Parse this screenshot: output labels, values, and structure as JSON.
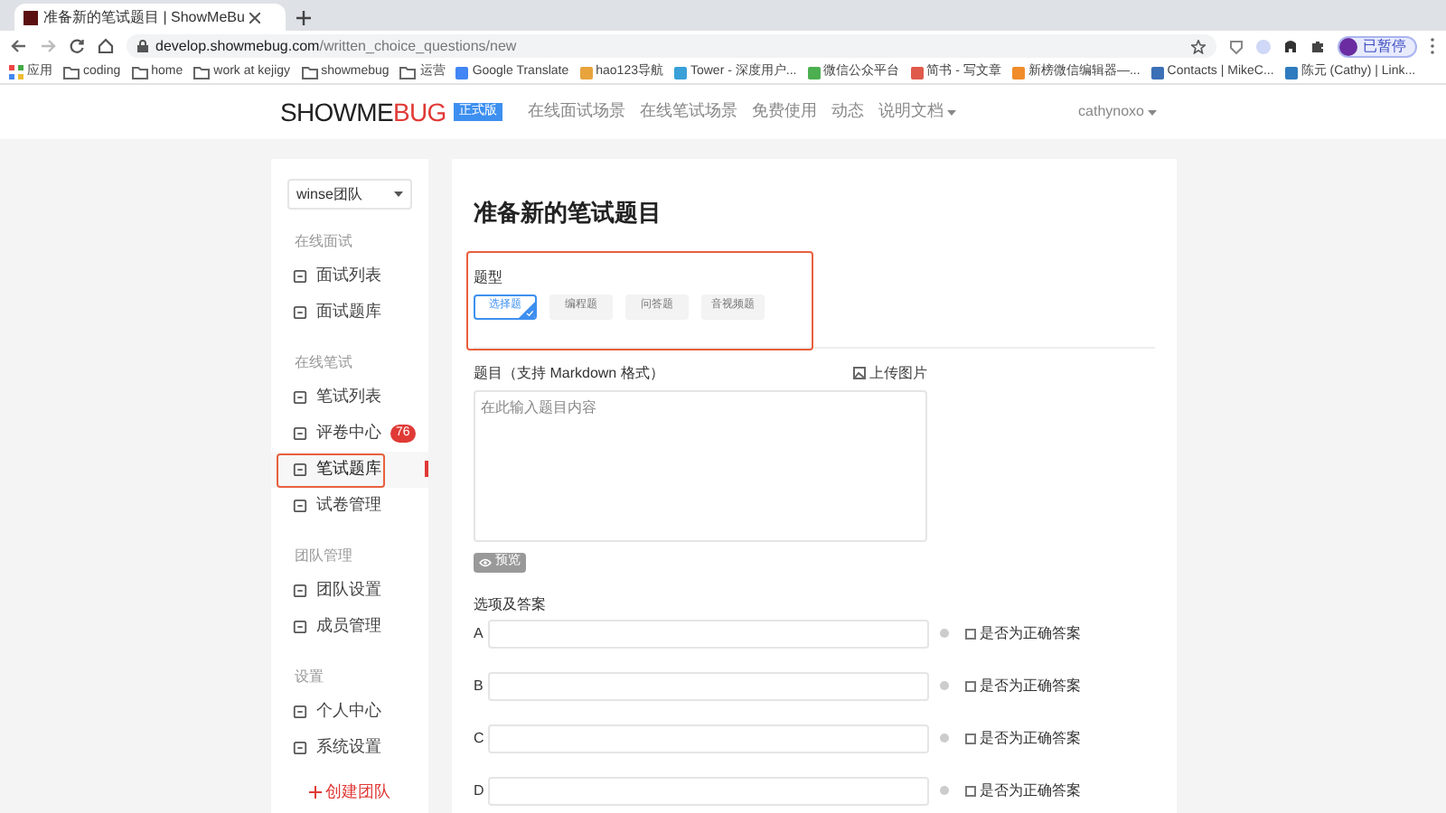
{
  "browser": {
    "tab_title": "准备新的笔试题目 | ShowMeBu",
    "url_host": "develop.showmebug.com",
    "url_path": "/written_choice_questions/new",
    "profile_label": "已暂停",
    "bookmarks": [
      {
        "label": "应用",
        "kind": "apps"
      },
      {
        "label": "coding",
        "kind": "folder"
      },
      {
        "label": "home",
        "kind": "folder"
      },
      {
        "label": "work at kejigy",
        "kind": "folder"
      },
      {
        "label": "showmebug",
        "kind": "folder"
      },
      {
        "label": "运营",
        "kind": "folder"
      },
      {
        "label": "Google Translate",
        "kind": "site",
        "color": "#4285f4"
      },
      {
        "label": "hao123导航",
        "kind": "site",
        "color": "#e8a33c"
      },
      {
        "label": "Tower - 深度用户...",
        "kind": "site",
        "color": "#3aa0d8"
      },
      {
        "label": "微信公众平台",
        "kind": "site",
        "color": "#4caf50"
      },
      {
        "label": "简书 - 写文章",
        "kind": "site",
        "color": "#e05a4b"
      },
      {
        "label": "新榜微信编辑器—...",
        "kind": "site",
        "color": "#f08c2a"
      },
      {
        "label": "Contacts | MikeC...",
        "kind": "site",
        "color": "#3b6fb6"
      },
      {
        "label": "陈元 (Cathy) | Link...",
        "kind": "site",
        "color": "#2f7bbf"
      }
    ]
  },
  "header": {
    "logo_dark": "SHOWME",
    "logo_red": "BUG",
    "edition_badge": "正式版",
    "nav": [
      {
        "label": "在线面试场景",
        "dropdown": false
      },
      {
        "label": "在线笔试场景",
        "dropdown": false
      },
      {
        "label": "免费使用",
        "dropdown": false
      },
      {
        "label": "动态",
        "dropdown": false
      },
      {
        "label": "说明文档",
        "dropdown": true
      }
    ],
    "user": "cathynoxo"
  },
  "sidebar": {
    "team_select": "winse团队",
    "sections": [
      {
        "title": "在线面试",
        "items": [
          {
            "label": "面试列表",
            "selected": false,
            "highlighted": false
          },
          {
            "label": "面试题库",
            "selected": false,
            "highlighted": false
          }
        ]
      },
      {
        "title": "在线笔试",
        "items": [
          {
            "label": "笔试列表",
            "selected": false,
            "highlighted": false
          },
          {
            "label": "评卷中心",
            "badge": "76",
            "selected": false,
            "highlighted": false
          },
          {
            "label": "笔试题库",
            "selected": true,
            "highlighted": true
          },
          {
            "label": "试卷管理",
            "selected": false,
            "highlighted": false
          }
        ]
      },
      {
        "title": "团队管理",
        "items": [
          {
            "label": "团队设置",
            "selected": false,
            "highlighted": false
          },
          {
            "label": "成员管理",
            "selected": false,
            "highlighted": false
          }
        ]
      },
      {
        "title": "设置",
        "items": [
          {
            "label": "个人中心",
            "selected": false,
            "highlighted": false
          },
          {
            "label": "系统设置",
            "selected": false,
            "highlighted": false
          }
        ]
      }
    ],
    "create_team": "创建团队"
  },
  "main": {
    "title": "准备新的笔试题目",
    "type_section": {
      "label": "题型",
      "highlighted": true,
      "types": [
        {
          "label": "选择题",
          "selected": true
        },
        {
          "label": "编程题",
          "selected": false
        },
        {
          "label": "问答题",
          "selected": false
        },
        {
          "label": "音视频题",
          "selected": false
        }
      ]
    },
    "question_label": "题目（支持 Markdown 格式）",
    "upload_image": "上传图片",
    "question_placeholder": "在此输入题目内容",
    "preview_button": "预览",
    "options_label": "选项及答案",
    "options": [
      {
        "letter": "A",
        "correct_label": "是否为正确答案",
        "checked": false
      },
      {
        "letter": "B",
        "correct_label": "是否为正确答案",
        "checked": false
      },
      {
        "letter": "C",
        "correct_label": "是否为正确答案",
        "checked": false
      },
      {
        "letter": "D",
        "correct_label": "是否为正确答案",
        "checked": false
      }
    ]
  }
}
